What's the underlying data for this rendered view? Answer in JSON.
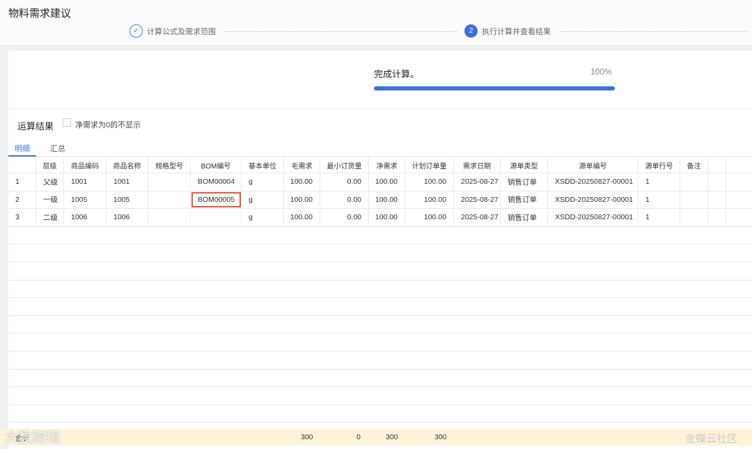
{
  "page_title": "物料需求建议",
  "steps": [
    {
      "index": "✓",
      "label": "计算公式及需求范围"
    },
    {
      "index": "2",
      "label": "执行计算并查看结果"
    }
  ],
  "progress": {
    "status": "完成计算。",
    "percent_label": "100%",
    "percent": 100
  },
  "results": {
    "title": "运算结果",
    "filter_label": "净需求为0的不显示"
  },
  "tabs": [
    {
      "label": "明细"
    },
    {
      "label": "汇总"
    }
  ],
  "table": {
    "columns": [
      "",
      "层级",
      "商品编码",
      "商品名称",
      "规格型号",
      "BOM编号",
      "基本单位",
      "毛需求",
      "最小订货量",
      "净需求",
      "计划订单量",
      "需求日期",
      "源单类型",
      "源单编号",
      "源单行号",
      "备注"
    ],
    "rows": [
      [
        "1",
        "父级",
        "1001",
        "1001",
        "",
        "BOM00004",
        "g",
        "100.00",
        "0.00",
        "100.00",
        "100.00",
        "2025-08-27",
        "销售订单",
        "XSDD-20250827-00001",
        "1",
        ""
      ],
      [
        "2",
        "一级",
        "1005",
        "1005",
        "",
        "BOM00005",
        "g",
        "100.00",
        "0.00",
        "100.00",
        "100.00",
        "2025-08-27",
        "销售订单",
        "XSDD-20250827-00001",
        "1",
        ""
      ],
      [
        "3",
        "二级",
        "1006",
        "1006",
        "",
        "",
        "g",
        "100.00",
        "0.00",
        "100.00",
        "100.00",
        "2025-08-27",
        "销售订单",
        "XSDD-20250827-00001",
        "1",
        ""
      ]
    ],
    "highlighted_cell": {
      "row": 1,
      "col": 5
    }
  },
  "totals": {
    "label": "合计",
    "gross": "300",
    "min_order": "0",
    "net": "300",
    "planned": "300"
  },
  "watermarks": {
    "left": "大数跨境",
    "right": "金蝶云社区"
  },
  "colors": {
    "accent": "#3c72e3",
    "highlight": "#e05a3a",
    "total_bg": "#fdf3d9"
  }
}
